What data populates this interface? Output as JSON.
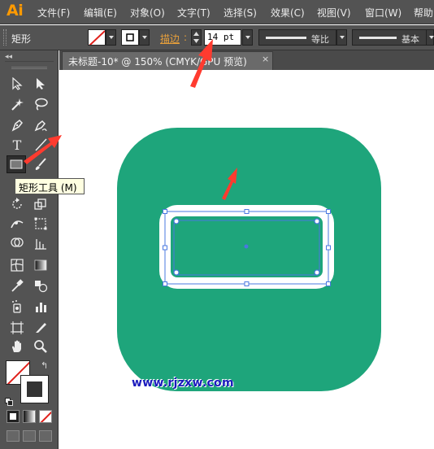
{
  "app": {
    "logo": "Ai"
  },
  "menu": {
    "items": [
      "文件(F)",
      "编辑(E)",
      "对象(O)",
      "文字(T)",
      "选择(S)",
      "效果(C)",
      "视图(V)",
      "窗口(W)",
      "帮助"
    ]
  },
  "control_bar": {
    "object_label": "矩形",
    "stroke_label": "描边",
    "stroke_colon": ":",
    "stroke_value": "14 pt",
    "line_profile_label": "等比",
    "brush_label": "基本"
  },
  "document": {
    "tab_title": "未标题-10* @ 150% (CMYK/GPU 预览)",
    "tab_close": "×"
  },
  "tools": {
    "collapse": "◂◂",
    "type_glyph": "T",
    "tooltip": "矩形工具 (M)"
  },
  "artwork": {
    "background_color": "#1ea57b",
    "inner_color": "#1ea57b",
    "stroke_color": "#ffffff",
    "selection_color": "#4a78e0",
    "annotation_color": "#ff3b2f"
  },
  "watermark": "www.rjzxw.com"
}
